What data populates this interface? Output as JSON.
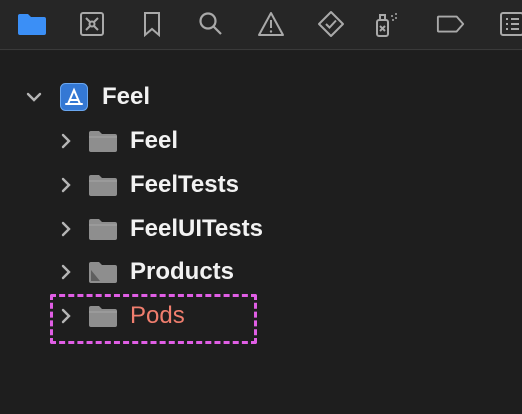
{
  "toolbar": {
    "icons": [
      {
        "name": "folder-icon",
        "active": true
      },
      {
        "name": "source-control-icon"
      },
      {
        "name": "bookmark-icon"
      },
      {
        "name": "search-icon"
      },
      {
        "name": "warning-icon"
      },
      {
        "name": "test-diamond-icon"
      },
      {
        "name": "debug-spray-icon"
      },
      {
        "name": "breakpoint-icon"
      },
      {
        "name": "report-icon"
      }
    ],
    "accent_color": "#3b8ff6",
    "icon_color": "#a9a9a9"
  },
  "tree": {
    "root": {
      "label": "Feel",
      "icon": "app-project-icon",
      "expanded": true
    },
    "children": [
      {
        "label": "Feel",
        "icon": "folder-icon",
        "expanded": false
      },
      {
        "label": "FeelTests",
        "icon": "folder-icon",
        "expanded": false
      },
      {
        "label": "FeelUITests",
        "icon": "folder-icon",
        "expanded": false
      },
      {
        "label": "Products",
        "icon": "products-folder-icon",
        "expanded": false
      },
      {
        "label": "Pods",
        "icon": "folder-icon",
        "expanded": false,
        "color": "#f07e6e",
        "highlighted": true
      }
    ]
  },
  "highlight_color": "#e05ee5"
}
